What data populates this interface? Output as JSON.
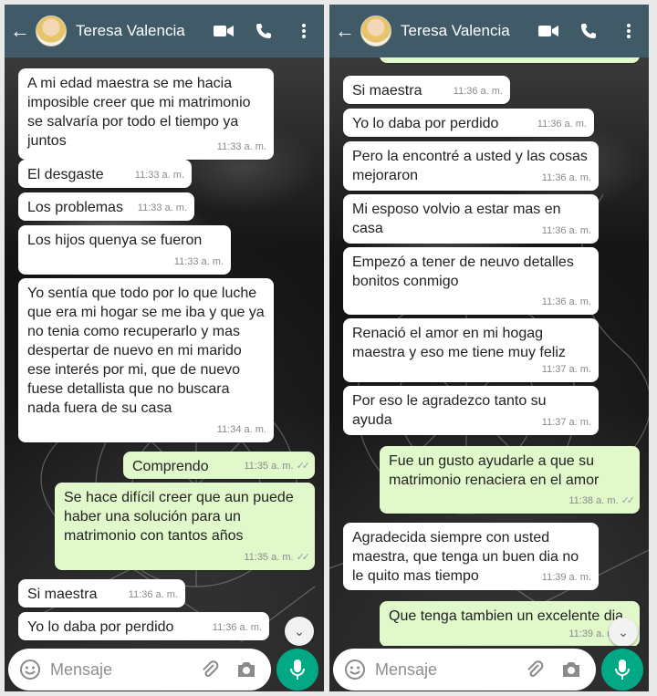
{
  "contact": {
    "name": "Teresa Valencia"
  },
  "input": {
    "placeholder": "Mensaje"
  },
  "colors": {
    "header": "#415a68",
    "outgoing": "#e1f8cb",
    "incoming": "#ffffff",
    "mic": "#00a884"
  },
  "icons": [
    "back-arrow-icon",
    "video-call-icon",
    "phone-icon",
    "more-vert-icon",
    "emoji-icon",
    "attach-icon",
    "camera-icon",
    "mic-icon",
    "chevron-double-down-icon",
    "double-check-icon"
  ],
  "left_messages": [
    {
      "dir": "in",
      "text": "A mi edad maestra se me hacia imposible creer que mi matrimonio se salvaría por todo el tiempo ya juntos",
      "time": "11:33 a. m."
    },
    {
      "dir": "in",
      "text": "El desgaste",
      "time": "11:33 a. m."
    },
    {
      "dir": "in",
      "text": "Los problemas",
      "time": "11:33 a. m."
    },
    {
      "dir": "in",
      "text": "Los hijos quenya se fueron",
      "time": "11:33 a. m."
    },
    {
      "dir": "in",
      "text": "Yo sentía que todo por lo que luche que era mi hogar se me iba y que ya no tenia como recuperarlo y mas despertar de nuevo en mi marido ese interés por mi, que de nuevo fuese detallista que no buscara nada fuera de su casa",
      "time": "11:34 a. m."
    },
    {
      "dir": "out",
      "text": "Comprendo",
      "time": "11:35 a. m."
    },
    {
      "dir": "out",
      "text": "Se hace difícil creer que aun puede haber una solución para un matrimonio con tantos años",
      "time": "11:35 a. m."
    },
    {
      "dir": "in",
      "text": "Si maestra",
      "time": "11:36 a. m."
    },
    {
      "dir": "in",
      "text": "Yo lo daba por perdido",
      "time": "11:36 a. m."
    }
  ],
  "right_messages": [
    {
      "dir": "in",
      "text": "Si maestra",
      "time": "11:36 a. m."
    },
    {
      "dir": "in",
      "text": "Yo lo daba por perdido",
      "time": "11:36 a. m."
    },
    {
      "dir": "in",
      "text": "Pero la encontré a usted y las cosas mejoraron",
      "time": "11:36 a. m."
    },
    {
      "dir": "in",
      "text": "Mi esposo volvio a estar mas en casa",
      "time": "11:36 a. m."
    },
    {
      "dir": "in",
      "text": "Empezó a tener de neuvo detalles bonitos conmigo",
      "time": "11:36 a. m."
    },
    {
      "dir": "in",
      "text": "Renació el amor en mi hogag maestra y eso me tiene muy feliz",
      "time": "11:37 a. m."
    },
    {
      "dir": "in",
      "text": "Por eso le agradezco tanto su ayuda",
      "time": "11:37 a. m."
    },
    {
      "dir": "out",
      "text": "Fue un gusto ayudarle a que su matrimonio renaciera en el amor",
      "time": "11:38 a. m."
    },
    {
      "dir": "in",
      "text": "Agradecida siempre con usted maestra, que tenga un buen dia no le quito mas tiempo",
      "time": "11:39 a. m."
    },
    {
      "dir": "out",
      "text": "Que tenga tambien un excelente dia",
      "time": "11:39 a. m."
    }
  ]
}
